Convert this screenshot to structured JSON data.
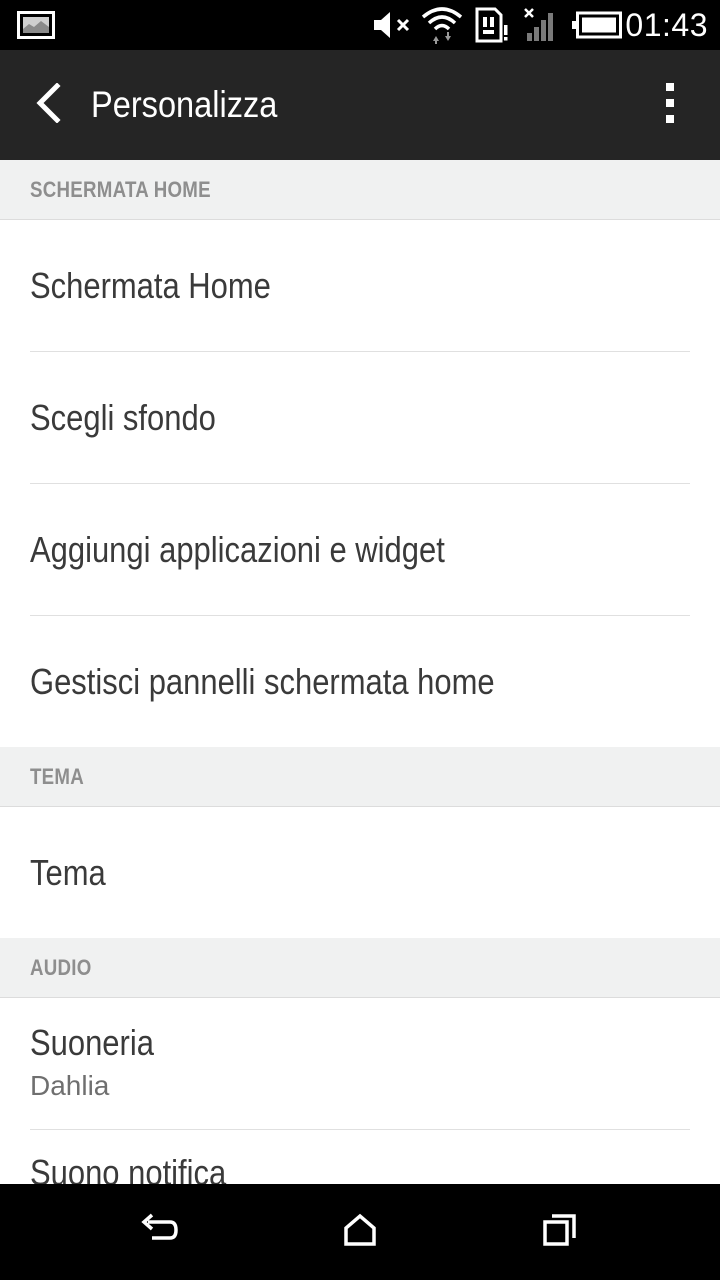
{
  "status_bar": {
    "time": "01:43"
  },
  "action_bar": {
    "title": "Personalizza"
  },
  "sections": {
    "home": {
      "header": "SCHERMATA HOME",
      "items": [
        {
          "title": "Schermata Home"
        },
        {
          "title": "Scegli sfondo"
        },
        {
          "title": "Aggiungi applicazioni e widget"
        },
        {
          "title": "Gestisci pannelli schermata home"
        }
      ]
    },
    "theme": {
      "header": "TEMA",
      "items": [
        {
          "title": "Tema"
        }
      ]
    },
    "audio": {
      "header": "AUDIO",
      "items": [
        {
          "title": "Suoneria",
          "subtitle": "Dahlia"
        },
        {
          "title": "Suono notifica"
        }
      ]
    }
  },
  "colors": {
    "status_bar_bg": "#000000",
    "action_bar_bg": "#252525",
    "section_header_bg": "#f0f1f1",
    "section_header_text": "#8e8e8e",
    "item_text": "#3a3a3a",
    "divider": "#e0e0e0"
  },
  "icons": {
    "status_left": "gallery-notification-icon",
    "status_right": [
      "mute-icon",
      "wifi-icon",
      "sim-alert-icon",
      "no-signal-icon",
      "battery-icon"
    ],
    "action_bar": [
      "back-arrow-icon",
      "overflow-menu-icon"
    ],
    "nav_bar": [
      "back-nav-icon",
      "home-nav-icon",
      "recent-apps-icon"
    ]
  }
}
